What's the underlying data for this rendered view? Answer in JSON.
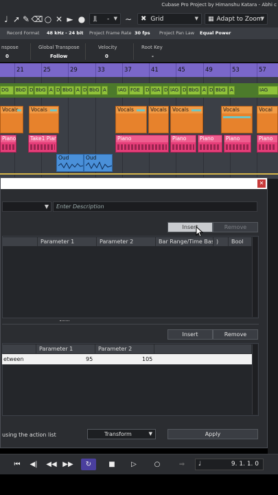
{
  "window": {
    "title": "Cubase Pro Project by Himanshu Katara - Abhi c"
  },
  "toolbar": {
    "snap_icon": "snap-wave-icon",
    "quantize_value": "-",
    "grid_label": "Grid",
    "adapt_label": "Adapt to Zoom"
  },
  "infobar": {
    "record_format_label": "Record Format",
    "record_format_value": "48 kHz - 24 bit",
    "frame_rate_label": "Project Frame Rate",
    "frame_rate_value": "30 fps",
    "pan_law_label": "Project Pan Law",
    "pan_law_value": "Equal Power"
  },
  "values": {
    "transpose_label": "nspose",
    "transpose_value": "0",
    "global_transpose_label": "Global Transpose",
    "global_transpose_value": "Follow",
    "velocity_label": "Velocity",
    "velocity_value": "0",
    "root_key_label": "Root Key",
    "root_key_value": "-"
  },
  "ruler": {
    "bars": [
      "21",
      "25",
      "29",
      "33",
      "37",
      "41",
      "45",
      "49",
      "53",
      "57"
    ]
  },
  "chords": [
    [
      "DG",
      "BbD",
      "D",
      "BbG",
      "A",
      "D",
      "BbG",
      "A",
      "D",
      "BbG",
      "A"
    ],
    [
      "IAG",
      "FGE",
      "D",
      "IGA",
      "D",
      "IAG",
      "D",
      "BbG",
      "A",
      "D",
      "BbG",
      "A"
    ],
    [
      "IAG"
    ]
  ],
  "events": {
    "vocals": [
      "Vocals",
      "Vocals",
      "Vocals",
      "Vocals",
      "Vocals",
      "Vocals",
      "Vocal"
    ],
    "pianos": [
      "Piano",
      "Take1 Piano",
      "Piano",
      "Piano",
      "Piano",
      "Piano",
      "Piano"
    ],
    "ouds": [
      "Oud",
      "Oud"
    ]
  },
  "dialog": {
    "description_placeholder": "Enter Description",
    "insert_label": "Insert",
    "remove_label": "Remove",
    "upper_headers": [
      "Parameter 1",
      "Parameter 2",
      "Bar Range/Time Base",
      ")",
      "Bool"
    ],
    "lower_insert_label": "Insert",
    "lower_remove_label": "Remove",
    "lower_headers": [
      "Parameter 1",
      "Parameter 2"
    ],
    "lower_row": {
      "condition": "etween",
      "param1": "95",
      "param2": "105"
    },
    "action_text": "using the action list",
    "function_value": "Transform",
    "apply_label": "Apply"
  },
  "transport": {
    "position": "9. 1. 1.  0"
  }
}
